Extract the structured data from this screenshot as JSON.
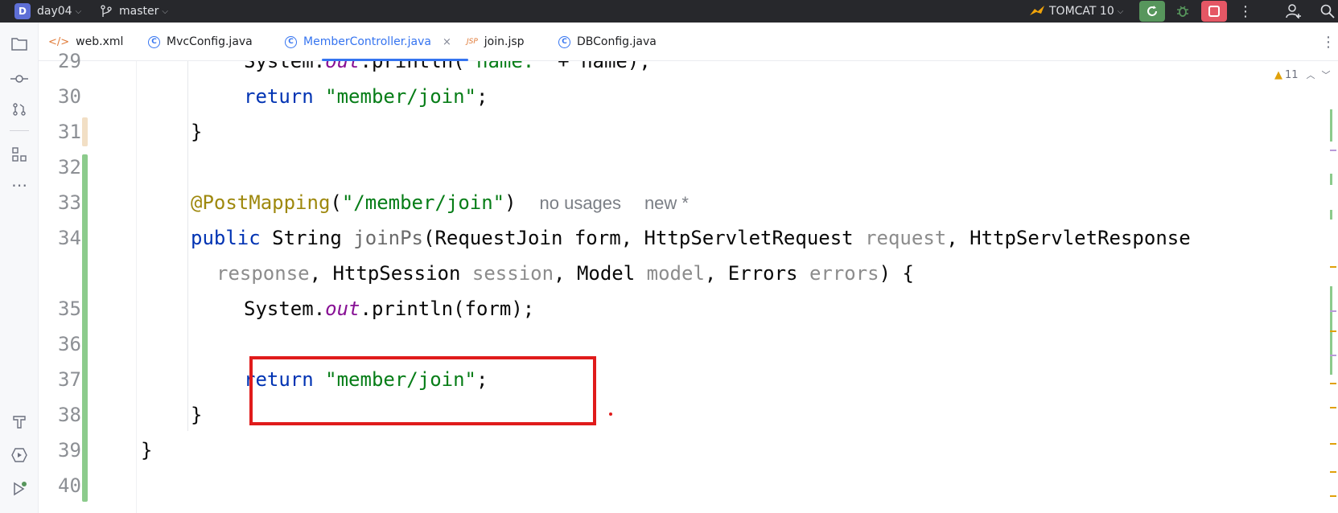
{
  "titlebar": {
    "project_badge": "D",
    "project_name": "day04",
    "branch_icon": "git-branch-icon",
    "branch": "master",
    "run_config": "TOMCAT 10",
    "colors": {
      "run_bg": "#57965c",
      "stop_bg": "#e55765",
      "debug": "#57965c"
    }
  },
  "tabs": [
    {
      "label": "web.xml",
      "icon": "</>"
    },
    {
      "label": "MvcConfig.java",
      "icon": "C"
    },
    {
      "label": "MemberController.java",
      "icon": "C",
      "active": true,
      "close": "×"
    },
    {
      "label": "join.jsp",
      "icon": "JSP"
    },
    {
      "label": "DBConfig.java",
      "icon": "C"
    }
  ],
  "editor": {
    "warning_count": "11",
    "line_numbers": [
      "29",
      "30",
      "31",
      "32",
      "33",
      "34",
      "35",
      "36",
      "37",
      "38",
      "39",
      "40"
    ],
    "l29": {
      "pre": "System.",
      "field": "out",
      "post": ".println(",
      "str": "\"name:\"",
      "tail": " + name);"
    },
    "l30": {
      "kw": "return",
      "str": "\"member/join\"",
      "tail": ";"
    },
    "l31": {
      "text": "}"
    },
    "l33": {
      "ann": "@PostMapping",
      "open": "(",
      "str": "\"/member/join\"",
      "close": ")",
      "hint_usages": "no usages",
      "hint_new": "new *"
    },
    "l34": {
      "kw": "public",
      "type": " String ",
      "method": "joinPs",
      "p1": "(RequestJoin form, HttpServletRequest ",
      "request": "request",
      "p2": ", HttpServletResponse"
    },
    "l34b": {
      "response": "response",
      "p3": ", HttpSession ",
      "session": "session",
      "p4": ", Model ",
      "model": "model",
      "p5": ", Errors ",
      "errors": "errors",
      "p6": ") {"
    },
    "l35": {
      "pre": "System.",
      "field": "out",
      "post": ".println(form);"
    },
    "l37": {
      "kw": "return",
      "str": "\"member/join\"",
      "tail": ";"
    },
    "l38": {
      "text": "}"
    },
    "l39": {
      "text": "}"
    }
  }
}
